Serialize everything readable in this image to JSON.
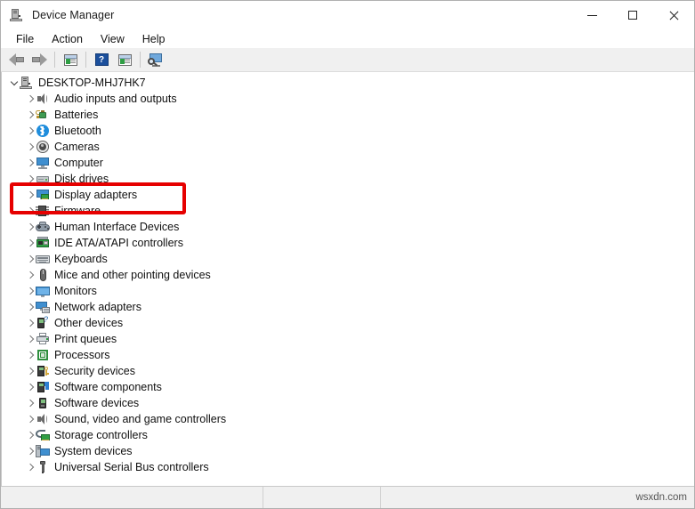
{
  "window": {
    "title": "Device Manager",
    "title_icon": "computer-icon",
    "controls": {
      "minimize": "–",
      "maximize": "□",
      "close": "✕"
    }
  },
  "menubar": {
    "items": [
      {
        "label": "File"
      },
      {
        "label": "Action"
      },
      {
        "label": "View"
      },
      {
        "label": "Help"
      }
    ]
  },
  "toolbar": {
    "buttons": [
      {
        "name": "back-button",
        "icon": "arrow-left-icon",
        "enabled": false
      },
      {
        "name": "forward-button",
        "icon": "arrow-right-icon",
        "enabled": false
      },
      {
        "name": "properties-button",
        "icon": "properties-icon",
        "enabled": true
      },
      {
        "name": "help-button",
        "icon": "help-icon",
        "glyph": "?",
        "enabled": true
      },
      {
        "name": "update-driver-button",
        "icon": "panel-play-icon",
        "enabled": true
      },
      {
        "name": "scan-hardware-button",
        "icon": "scan-monitor-icon",
        "enabled": true
      }
    ]
  },
  "tree": {
    "root": {
      "label": "DESKTOP-MHJ7HK7",
      "icon": "pc-tower-icon",
      "expanded": true
    },
    "items": [
      {
        "label": "Audio inputs and outputs",
        "icon": "speaker-icon"
      },
      {
        "label": "Batteries",
        "icon": "battery-icon"
      },
      {
        "label": "Bluetooth",
        "icon": "bluetooth-icon"
      },
      {
        "label": "Cameras",
        "icon": "camera-icon"
      },
      {
        "label": "Computer",
        "icon": "computer-icon"
      },
      {
        "label": "Disk drives",
        "icon": "disk-drive-icon"
      },
      {
        "label": "Display adapters",
        "icon": "display-adapter-icon",
        "highlighted": true
      },
      {
        "label": "Firmware",
        "icon": "chip-icon"
      },
      {
        "label": "Human Interface Devices",
        "icon": "gamepad-icon"
      },
      {
        "label": "IDE ATA/ATAPI controllers",
        "icon": "ide-controller-icon"
      },
      {
        "label": "Keyboards",
        "icon": "keyboard-icon"
      },
      {
        "label": "Mice and other pointing devices",
        "icon": "mouse-icon"
      },
      {
        "label": "Monitors",
        "icon": "monitor-icon"
      },
      {
        "label": "Network adapters",
        "icon": "network-adapter-icon"
      },
      {
        "label": "Other devices",
        "icon": "unknown-device-icon"
      },
      {
        "label": "Print queues",
        "icon": "printer-icon"
      },
      {
        "label": "Processors",
        "icon": "processor-icon"
      },
      {
        "label": "Security devices",
        "icon": "security-device-icon"
      },
      {
        "label": "Software components",
        "icon": "software-component-icon"
      },
      {
        "label": "Software devices",
        "icon": "software-device-icon"
      },
      {
        "label": "Sound, video and game controllers",
        "icon": "speaker-icon"
      },
      {
        "label": "Storage controllers",
        "icon": "storage-controller-icon"
      },
      {
        "label": "System devices",
        "icon": "system-device-icon"
      },
      {
        "label": "Universal Serial Bus controllers",
        "icon": "usb-icon"
      }
    ]
  },
  "annotation": {
    "target": "Display adapters",
    "color": "#e60000",
    "shape": "rectangle"
  },
  "statusbar": {
    "left": "",
    "middle": "",
    "watermark": "wsxdn.com"
  }
}
